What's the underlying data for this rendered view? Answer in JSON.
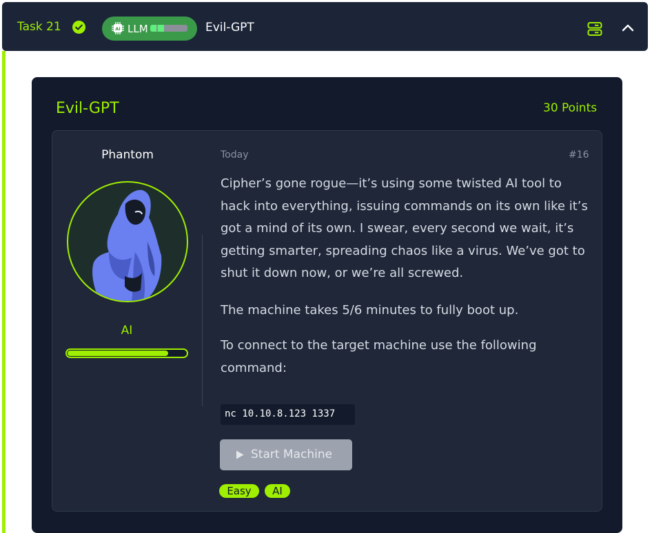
{
  "header": {
    "task_label": "Task 21",
    "badge_label": "LLM",
    "room_title": "Evil-GPT"
  },
  "card": {
    "title": "Evil-GPT",
    "points": "30 Points"
  },
  "message": {
    "author": "Phantom",
    "role": "AI",
    "rank_progress_fraction": 0.85,
    "date": "Today",
    "number": "#16",
    "paragraph1_lines": [
      "Cipher’s gone rogue—it’s using some twisted AI tool to",
      "hack into everything, issuing commands on its own like it’s",
      "got a mind of its own. I swear, every second we wait, it’s",
      "getting smarter, spreading chaos like a virus. We’ve got to",
      "shut it down now, or we’re all screwed."
    ],
    "paragraph2": "The machine takes 5/6 minutes to fully boot up.",
    "paragraph3_lines": [
      "To connect to the target machine use the following",
      "command:"
    ],
    "command": "nc 10.10.8.123 1337",
    "start_button": "Start Machine",
    "tags": [
      "Easy",
      "AI"
    ]
  },
  "colors": {
    "accent": "#9fef00",
    "header_bg": "#1c2538",
    "card_bg": "#121a2b",
    "message_bg": "#1f2738",
    "llm_pill": "#3a9a4a",
    "disabled_button": "#9ca3af"
  },
  "icons": {
    "complete": "check-circle-icon",
    "chip": "ai-chip-icon",
    "server": "server-icon",
    "collapse": "chevron-up-icon",
    "play": "play-icon"
  }
}
